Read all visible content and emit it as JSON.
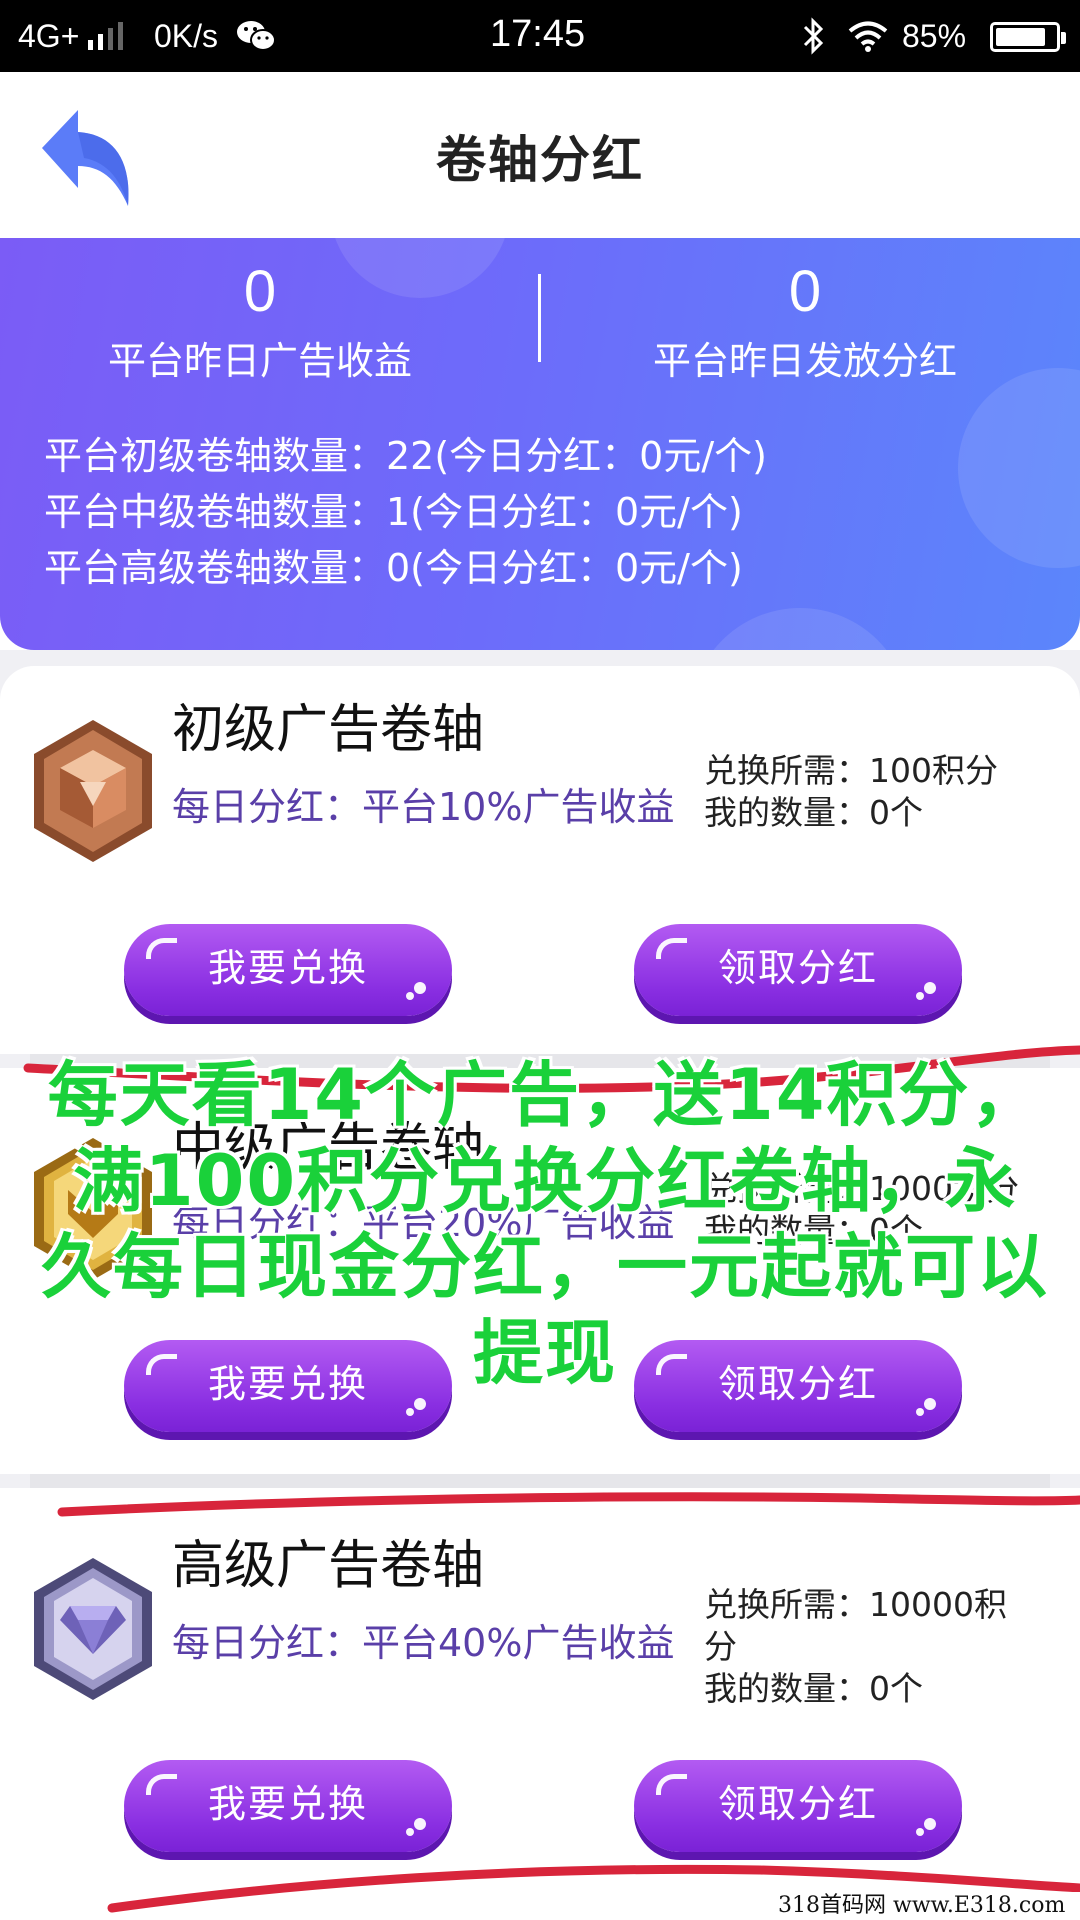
{
  "status_bar": {
    "network": "4G+",
    "speed": "0K/s",
    "time": "17:45",
    "battery": "85%",
    "battery_level": 0.85,
    "icons": [
      "signal-icon",
      "wechat-icon",
      "bluetooth-icon",
      "wifi-icon",
      "battery-icon"
    ]
  },
  "header": {
    "title": "卷轴分红",
    "back_icon": "back-arrow-icon"
  },
  "banner": {
    "yesterday_ad_income_value": "0",
    "yesterday_ad_income_label": "平台昨日广告收益",
    "yesterday_dividend_value": "0",
    "yesterday_dividend_label": "平台昨日发放分红",
    "tier_lines": [
      "平台初级卷轴数量：22(今日分红：0元/个)",
      "平台中级卷轴数量：1(今日分红：0元/个)",
      "平台高级卷轴数量：0(今日分红：0元/个)"
    ]
  },
  "cards": [
    {
      "title": "初级广告卷轴",
      "bonus": "每日分红：平台10%广告收益",
      "cost": "兑换所需：100积分",
      "owned": "我的数量：0个",
      "badge_icon": "bronze-badge-icon",
      "exchange_label": "我要兑换",
      "claim_label": "领取分红"
    },
    {
      "title": "中级广告卷轴",
      "bonus": "每日分红：平台20%广告收益",
      "cost": "兑换所需：1000积分",
      "owned": "我的数量：0个",
      "badge_icon": "gold-badge-icon",
      "exchange_label": "我要兑换",
      "claim_label": "领取分红"
    },
    {
      "title": "高级广告卷轴",
      "bonus": "每日分红：平台40%广告收益",
      "cost": "兑换所需：10000积分",
      "owned": "我的数量：0个",
      "badge_icon": "diamond-badge-icon",
      "exchange_label": "我要兑换",
      "claim_label": "领取分红"
    }
  ],
  "overlay": {
    "promo_text": "每天看14个广告，送14积分，满100积分兑换分红卷轴，永久每日现金分红，一元起就可以提现",
    "watermark": "318首码网 www.E318.com"
  },
  "colors": {
    "banner_start": "#7b5cf6",
    "banner_end": "#5b86fb",
    "button": "#8a2fe2",
    "promo_text": "#1ad13a",
    "red_marker": "#d8253b",
    "back_arrow": "#5b7cf8"
  }
}
